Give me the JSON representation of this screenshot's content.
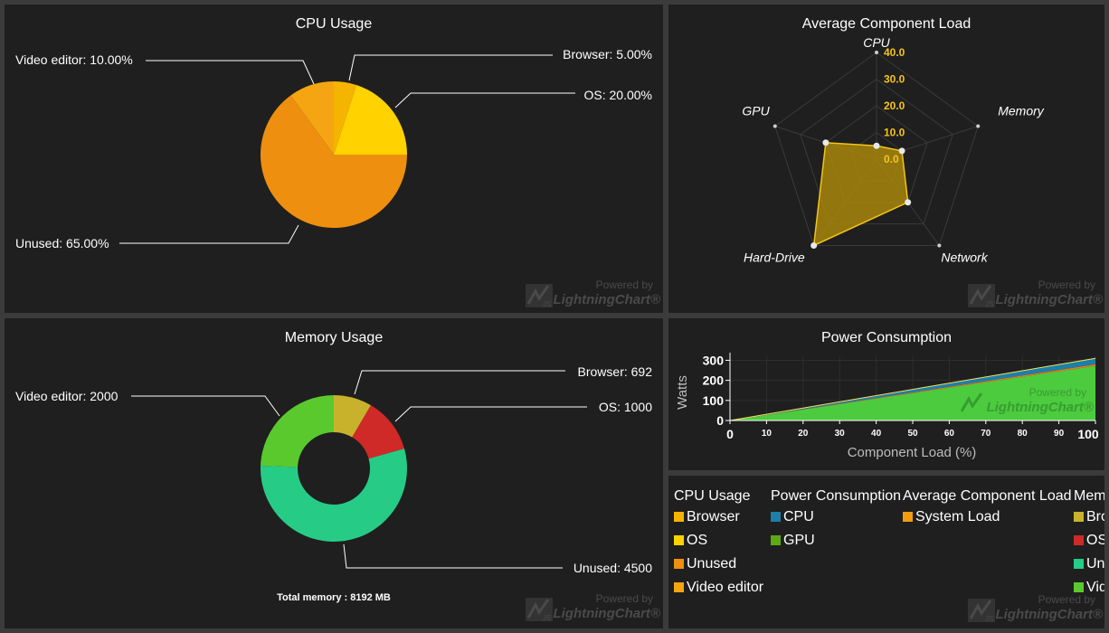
{
  "cpu_panel": {
    "title": "CPU Usage"
  },
  "radar_panel": {
    "title": "Average Component Load"
  },
  "memory_panel": {
    "title": "Memory Usage",
    "footer": "Total memory : 8192 MB"
  },
  "power_panel": {
    "title": "Power Consumption",
    "xlabel": "Component Load (%)",
    "ylabel": "Watts"
  },
  "watermark": {
    "line1": "Powered by",
    "line2": "LightningChart",
    "mark": "JS"
  },
  "legend": {
    "groups": [
      {
        "title": "CPU Usage",
        "items": [
          {
            "label": "Browser",
            "color": "#f5b400"
          },
          {
            "label": "OS",
            "color": "#ffd200"
          },
          {
            "label": "Unused",
            "color": "#ee8f0f"
          },
          {
            "label": "Video editor",
            "color": "#f4a511"
          }
        ]
      },
      {
        "title": "Power Consumption",
        "items": [
          {
            "label": "CPU",
            "color": "#1e7fa8"
          },
          {
            "label": "GPU",
            "color": "#5ea813"
          }
        ]
      },
      {
        "title": "Average Component Load",
        "items": [
          {
            "label": "System Load",
            "color": "#f39c12"
          }
        ]
      },
      {
        "title": "Memory Usage",
        "items": [
          {
            "label": "Browser",
            "color": "#c8b22c"
          },
          {
            "label": "OS",
            "color": "#cf2a27"
          },
          {
            "label": "Unused",
            "color": "#26cc86"
          },
          {
            "label": "Video editor",
            "color": "#5ac92e"
          }
        ]
      }
    ]
  },
  "chart_data": [
    {
      "type": "pie",
      "title": "CPU Usage",
      "slices": [
        {
          "name": "Browser",
          "value": 5.0,
          "label": "Browser: 5.00%",
          "color": "#f5b400"
        },
        {
          "name": "OS",
          "value": 20.0,
          "label": "OS: 20.00%",
          "color": "#ffd200"
        },
        {
          "name": "Unused",
          "value": 65.0,
          "label": "Unused: 65.00%",
          "color": "#ee8f0f"
        },
        {
          "name": "Video editor",
          "value": 10.0,
          "label": "Video editor: 10.00%",
          "color": "#f4a511"
        }
      ]
    },
    {
      "type": "radar",
      "title": "Average Component Load",
      "axes": [
        "CPU",
        "Memory",
        "Network",
        "Hard-Drive",
        "GPU"
      ],
      "range": [
        0,
        40
      ],
      "ticks": [
        "0.0",
        "10.0",
        "20.0",
        "30.0",
        "40.0"
      ],
      "series": [
        {
          "name": "System Load",
          "values": [
            5,
            10,
            20,
            40,
            20
          ],
          "color": "#f5c518"
        }
      ]
    },
    {
      "type": "pie",
      "title": "Memory Usage",
      "donut": true,
      "slices": [
        {
          "name": "Browser",
          "value": 692,
          "label": "Browser: 692",
          "color": "#c8b22c"
        },
        {
          "name": "OS",
          "value": 1000,
          "label": "OS: 1000",
          "color": "#cf2a27"
        },
        {
          "name": "Unused",
          "value": 4500,
          "label": "Unused: 4500",
          "color": "#26cc86"
        },
        {
          "name": "Video editor",
          "value": 2000,
          "label": "Video editor: 2000",
          "color": "#5ac92e"
        }
      ]
    },
    {
      "type": "area",
      "title": "Power Consumption",
      "xlabel": "Component Load (%)",
      "ylabel": "Watts",
      "xlim": [
        0,
        100
      ],
      "ylim": [
        0,
        320
      ],
      "xticks": [
        0,
        10,
        20,
        30,
        40,
        50,
        60,
        70,
        80,
        90,
        100
      ],
      "yticks": [
        0,
        100,
        200,
        300
      ],
      "x": [
        0,
        100
      ],
      "stacked": true,
      "series": [
        {
          "name": "GPU",
          "values": [
            0,
            272
          ],
          "color": "#4ccb3f"
        },
        {
          "name": "System Load",
          "values": [
            0,
            8
          ],
          "color": "#ee7a10"
        },
        {
          "name": "CPU",
          "values": [
            0,
            30
          ],
          "color": "#1e7fa8"
        }
      ]
    }
  ]
}
